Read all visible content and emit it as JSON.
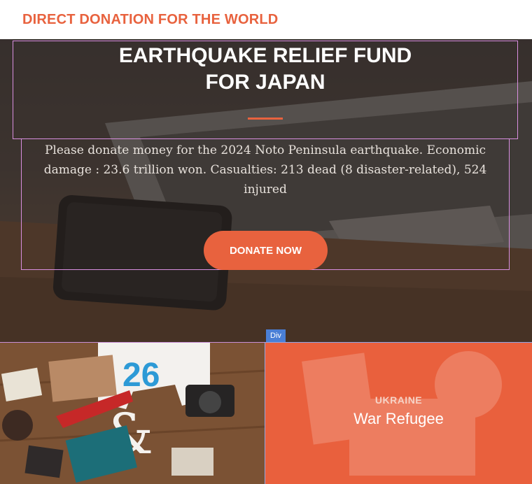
{
  "nav": {
    "brand": "DIRECT DONATION FOR THE WORLD"
  },
  "hero": {
    "title_line1": "EARTHQUAKE RELIEF FUND",
    "title_line2": "FOR JAPAN",
    "description": "Please donate money for the 2024 Noto Peninsula earthquake. Economic damage : 23.6 trillion won. Casualties: 213 dead (8 disaster-related), 524 injured",
    "donate_button": "DONATE NOW"
  },
  "inspector": {
    "div_tag": "Div"
  },
  "cards": {
    "right": {
      "kicker": "UKRAINE",
      "title": "War Refugee"
    }
  },
  "colors": {
    "accent": "#e8623e",
    "card_orange": "#e9603d",
    "inspector_blue": "#4a7fd6"
  }
}
